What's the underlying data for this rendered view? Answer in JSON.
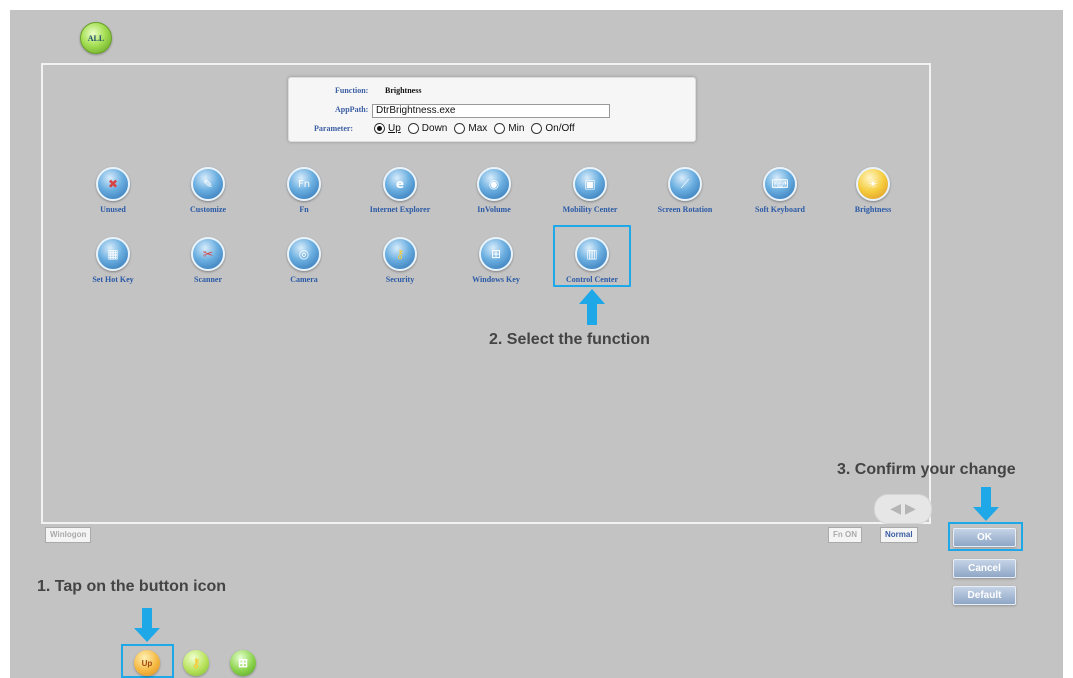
{
  "top_button": {
    "label": "ALL"
  },
  "info": {
    "function_label": "Function:",
    "function_value": "Brightness",
    "apppath_label": "AppPath:",
    "apppath_value": "DtrBrightness.exe",
    "parameter_label": "Parameter:",
    "parameters": [
      "Up",
      "Down",
      "Max",
      "Min",
      "On/Off"
    ],
    "selected_parameter": "Up"
  },
  "functions_row1": [
    {
      "name": "Unused",
      "icon": "unused-icon",
      "glyph": "✖"
    },
    {
      "name": "Customize",
      "icon": "customize-icon",
      "glyph": "✎"
    },
    {
      "name": "Fn",
      "icon": "fn-icon",
      "glyph": "Fn"
    },
    {
      "name": "Internet Explorer",
      "icon": "internet-explorer-icon",
      "glyph": "e"
    },
    {
      "name": "InVolume",
      "icon": "volume-icon",
      "glyph": "◉"
    },
    {
      "name": "Mobility Center",
      "icon": "mobility-center-icon",
      "glyph": "▣"
    },
    {
      "name": "Screen Rotation",
      "icon": "screen-rotation-icon",
      "glyph": "⟋"
    },
    {
      "name": "Soft Keyboard",
      "icon": "soft-keyboard-icon",
      "glyph": "⌨"
    },
    {
      "name": "Brightness",
      "icon": "brightness-icon",
      "glyph": "☀"
    }
  ],
  "functions_row2": [
    {
      "name": "Set Hot Key",
      "icon": "set-hot-key-icon",
      "glyph": "▦"
    },
    {
      "name": "Scanner",
      "icon": "scanner-icon",
      "glyph": "✂"
    },
    {
      "name": "Camera",
      "icon": "camera-icon",
      "glyph": "◎"
    },
    {
      "name": "Security",
      "icon": "security-icon",
      "glyph": "⚷"
    },
    {
      "name": "Windows Key",
      "icon": "windows-key-icon",
      "glyph": "⊞"
    },
    {
      "name": "Control Center",
      "icon": "control-center-icon",
      "glyph": "▥"
    }
  ],
  "captions": {
    "step1": "1. Tap on the button icon",
    "step2": "2. Select the function",
    "step3": "3. Confirm your change"
  },
  "bottom": {
    "winlogon": "Winlogon",
    "fn_on": "Fn ON",
    "normal": "Normal"
  },
  "actions": {
    "ok": "OK",
    "cancel": "Cancel",
    "default": "Default"
  },
  "buttons_bar": [
    {
      "label": "Up",
      "icon": "up-button-icon",
      "color": "#f5b840"
    },
    {
      "label": "",
      "icon": "security-button-icon",
      "color": "#b7e25a"
    },
    {
      "label": "",
      "icon": "windows-button-icon",
      "color": "#8ad24a"
    }
  ],
  "colors": {
    "highlight": "#1ea8e8",
    "label_blue": "#2b5aa6"
  }
}
